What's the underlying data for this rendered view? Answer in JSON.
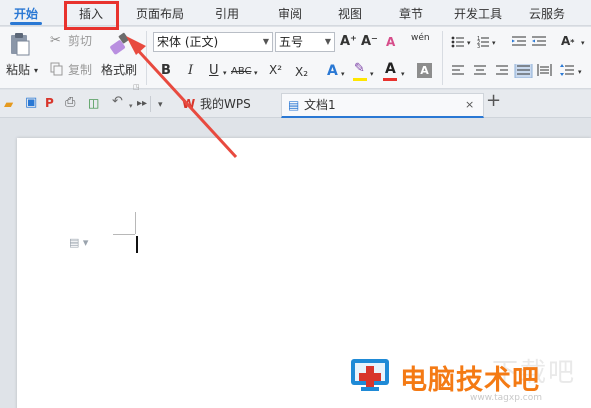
{
  "menu": {
    "tabs": [
      "开始",
      "插入",
      "页面布局",
      "引用",
      "审阅",
      "视图",
      "章节",
      "开发工具",
      "云服务"
    ],
    "active_tab": "开始",
    "highlighted_tab": "插入"
  },
  "ribbon": {
    "paste_label": "粘贴",
    "cut_label": "剪切",
    "copy_label": "复制",
    "format_painter_label": "格式刷",
    "font_name": "宋体 (正文)",
    "font_size": "五号",
    "bold": "B",
    "italic": "I",
    "underline": "U",
    "strikethrough": "ABC",
    "superscript": "X²",
    "subscript": "X₂",
    "text_effect": "A",
    "font_color": "A",
    "char_shading": "A",
    "grow_font": "A⁺",
    "shrink_font": "A⁻",
    "clear_format": "A",
    "phonetic": "wén"
  },
  "doc_tabs": {
    "home_tab": "我的WPS",
    "doc_tab": "文档1",
    "close": "×",
    "new_tab": "+"
  },
  "watermark": {
    "brand_text": "电脑技术吧",
    "site_text": "www.tagxp.com",
    "gray_text": "下载吧"
  },
  "colors": {
    "accent": "#2a78d4",
    "highlight_border": "#e8322d",
    "arrow": "#e84a3f",
    "brand": "#f47a14"
  }
}
